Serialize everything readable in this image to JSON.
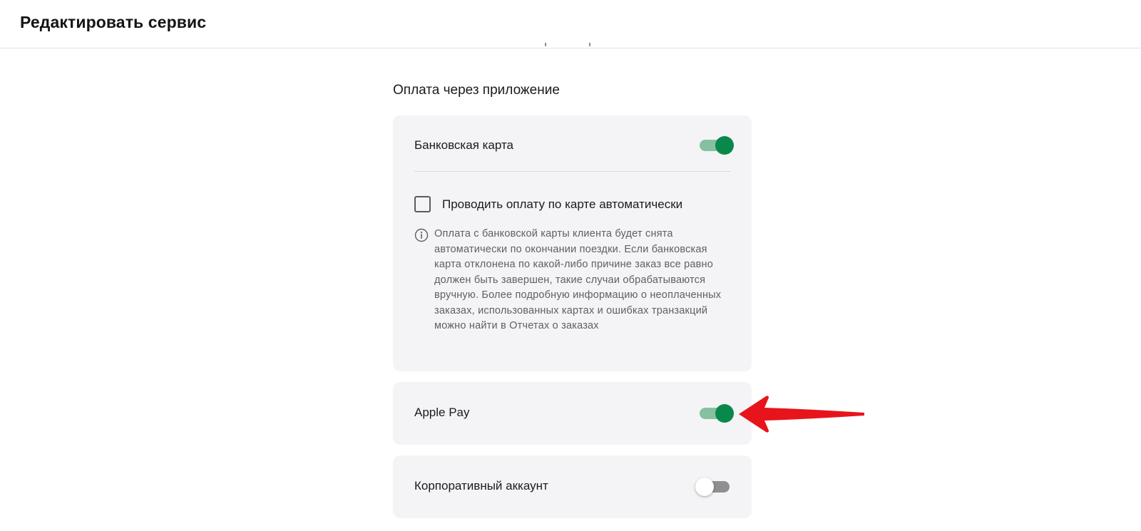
{
  "header": {
    "title": "Редактировать сервис"
  },
  "section": {
    "title": "Оплата через приложение"
  },
  "bank_card": {
    "label": "Банковская карта",
    "enabled": true,
    "auto_payment": {
      "label": "Проводить оплату по карте автоматически",
      "checked": false
    },
    "info_text": "Оплата с банковской карты клиента будет снята автоматически по окончании поездки. Если банковская карта отклонена по какой-либо причине заказ все равно должен быть завершен, такие случаи обрабатываются вручную. Более подробную информацию о неоплаченных заказах, использованных картах и ошибках транзакций можно найти в Отчетах о заказах"
  },
  "apple_pay": {
    "label": "Apple Pay",
    "enabled": true
  },
  "corporate": {
    "label": "Корпоративный аккаунт",
    "enabled": false
  },
  "colors": {
    "toggle_on_knob": "#08894b",
    "toggle_on_track": "#86c0a0",
    "toggle_off_track": "#8f8f8f",
    "card_bg": "#f4f4f6",
    "annotation_arrow": "#e8141c"
  },
  "icons": {
    "info": "info-circle-icon",
    "annotation": "red-arrow-icon"
  }
}
